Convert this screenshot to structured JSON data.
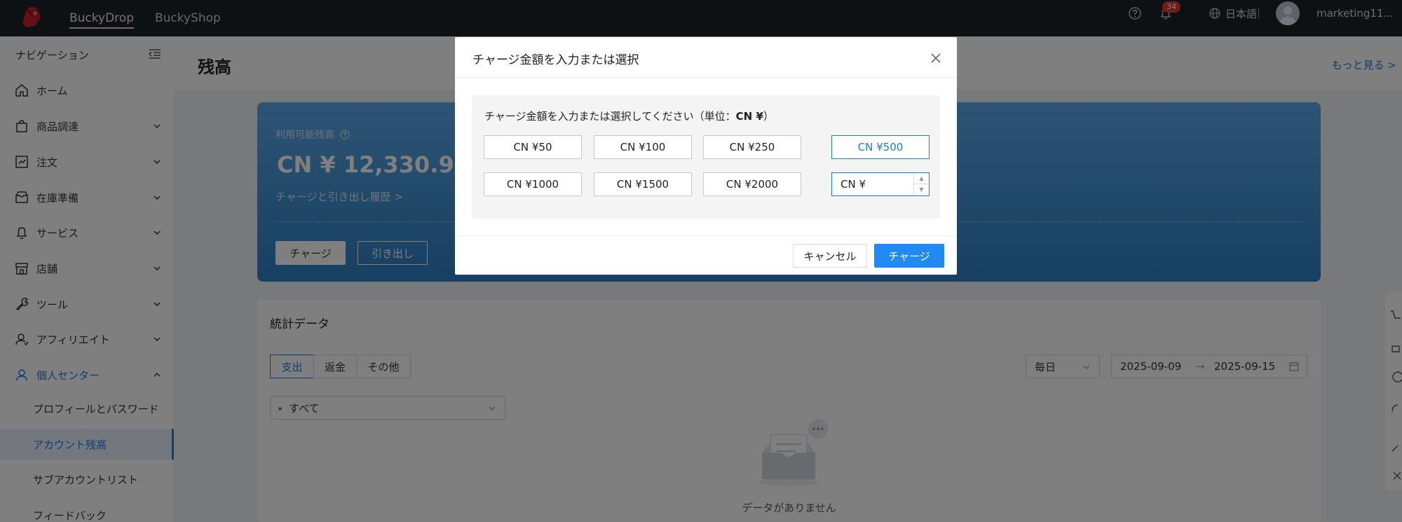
{
  "topbar": {
    "tabs": [
      "BuckyDrop",
      "BuckyShop"
    ],
    "notification_count": "34",
    "language": "日本語",
    "username": "marketing11..."
  },
  "sidebar": {
    "title": "ナビゲーション",
    "items": [
      {
        "label": "ホーム",
        "icon": "home-icon"
      },
      {
        "label": "商品調達",
        "icon": "shopping-bag-icon"
      },
      {
        "label": "注文",
        "icon": "order-icon"
      },
      {
        "label": "在庫準備",
        "icon": "inbox-icon"
      },
      {
        "label": "サービス",
        "icon": "bell-icon"
      },
      {
        "label": "店舗",
        "icon": "store-icon"
      },
      {
        "label": "ツール",
        "icon": "wrench-icon"
      },
      {
        "label": "アフィリエイト",
        "icon": "affiliate-icon"
      },
      {
        "label": "個人センター",
        "icon": "user-icon"
      }
    ],
    "subitems": [
      "プロフィールとパスワード",
      "アカウント残高",
      "サブアカウントリスト",
      "フィードバック"
    ]
  },
  "page": {
    "title": "残高",
    "more_link": "もっと見る >"
  },
  "balance": {
    "label": "利用可能残高",
    "amount": "CN ¥ 12,330.91",
    "history_link": "チャージと引き出し履歴 >",
    "charge_button": "チャージ",
    "withdraw_button": "引き出し"
  },
  "stats": {
    "title": "統計データ",
    "tabs": [
      "支出",
      "返金",
      "その他"
    ],
    "period": "毎日",
    "date_start": "2025-09-09",
    "date_sep": "→",
    "date_end": "2025-09-15",
    "filter": "すべて",
    "empty_text": "データがありません"
  },
  "modal": {
    "title": "チャージ金額を入力または選択",
    "prompt_prefix": "チャージ金額を入力または選択してください（単位：",
    "prompt_unit": "CN ¥",
    "prompt_suffix": "）",
    "amounts": [
      "CN ¥50",
      "CN ¥100",
      "CN ¥250",
      "CN ¥500",
      "CN ¥1000",
      "CN ¥1500",
      "CN ¥2000"
    ],
    "selected_amount": "CN ¥500",
    "input_value": "CN ¥",
    "cancel_button": "キャンセル",
    "confirm_button": "チャージ"
  },
  "colors": {
    "accent": "#1f7ae0",
    "topbar_bg": "#1d2227",
    "card_gradient_top": "#5aa8e6",
    "card_gradient_bottom": "#2d7fc4",
    "primary_button": "#1f8bf1"
  }
}
